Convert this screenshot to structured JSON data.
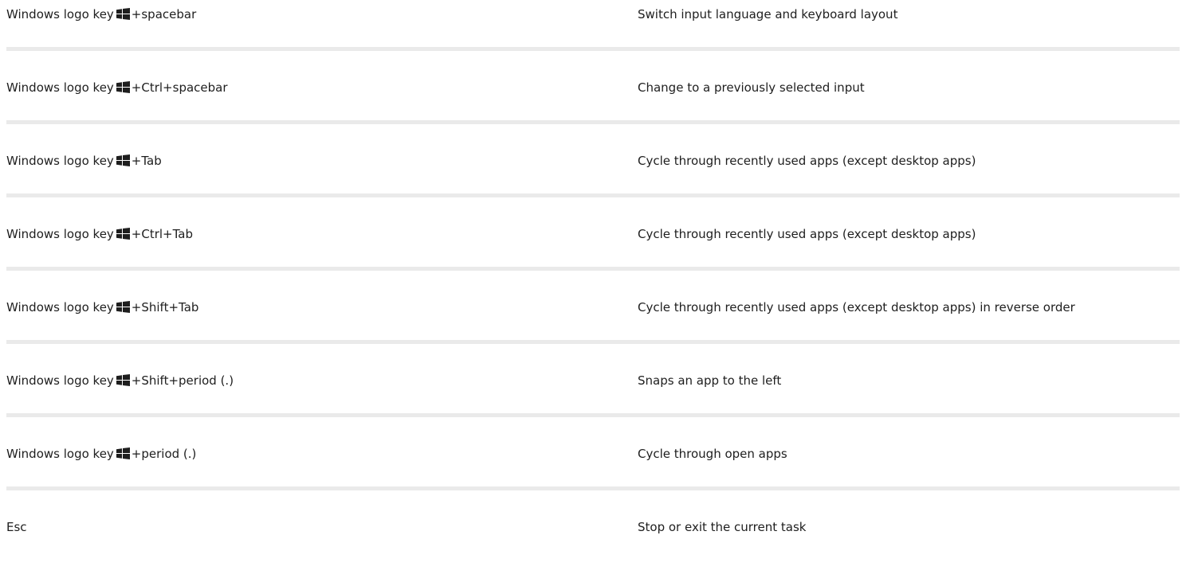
{
  "rows": [
    {
      "prefix": "Windows logo key",
      "has_icon": true,
      "keys": "+spacebar",
      "description": "Switch input language and keyboard layout"
    },
    {
      "prefix": "Windows logo key",
      "has_icon": true,
      "keys": "+Ctrl+spacebar",
      "description": "Change to a previously selected input"
    },
    {
      "prefix": "Windows logo key",
      "has_icon": true,
      "keys": "+Tab",
      "description": "Cycle through recently used apps (except desktop apps)"
    },
    {
      "prefix": "Windows logo key",
      "has_icon": true,
      "keys": "+Ctrl+Tab",
      "description": "Cycle through recently used apps (except desktop apps)"
    },
    {
      "prefix": "Windows logo key",
      "has_icon": true,
      "keys": "+Shift+Tab",
      "description": "Cycle through recently used apps (except desktop apps) in reverse order"
    },
    {
      "prefix": "Windows logo key",
      "has_icon": true,
      "keys": "+Shift+period (.)",
      "description": "Snaps an app to the left"
    },
    {
      "prefix": "Windows logo key",
      "has_icon": true,
      "keys": "+period (.)",
      "description": "Cycle through open apps"
    },
    {
      "prefix": "Esc",
      "has_icon": false,
      "keys": "",
      "description": "Stop or exit the current task"
    }
  ],
  "icon": {
    "name": "windows-logo-icon",
    "color": "#1e1e1e"
  },
  "divider_color": "#eaeaea"
}
